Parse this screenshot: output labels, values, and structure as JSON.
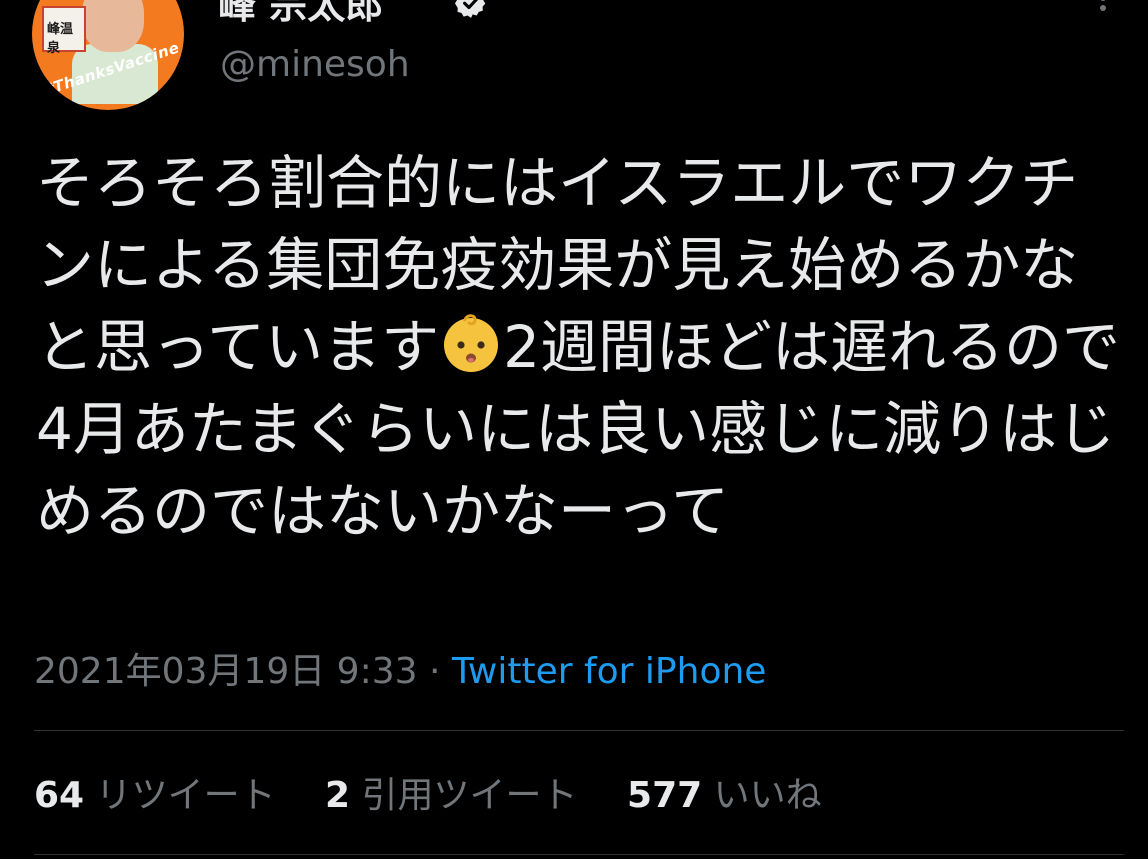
{
  "author": {
    "display_name": "峰 宗太郎",
    "handle": "@minesoh",
    "avatar_sign_text": "峰温泉",
    "avatar_banner_text": "#ThanksVaccine"
  },
  "tweet": {
    "text_before_emoji": "そろそろ割合的にはイスラエルでワクチンによる集団免疫効果が見え始めるかなと思っています",
    "emoji": "baby-face",
    "text_after_emoji": "2週間ほどは遅れるので4月あたまぐらいには良い感じに減りはじめるのではないかなーって"
  },
  "meta": {
    "timestamp": "2021年03月19日 9:33",
    "separator": " · ",
    "source": "Twitter for iPhone"
  },
  "stats": {
    "retweets_count": "64",
    "retweets_label": "リツイート",
    "quotes_count": "2",
    "quotes_label": "引用ツイート",
    "likes_count": "577",
    "likes_label": "いいね"
  },
  "colors": {
    "background": "#000000",
    "text": "#e7e9ea",
    "muted": "#71767b",
    "link": "#1d9bf0",
    "divider": "#2f3336"
  }
}
